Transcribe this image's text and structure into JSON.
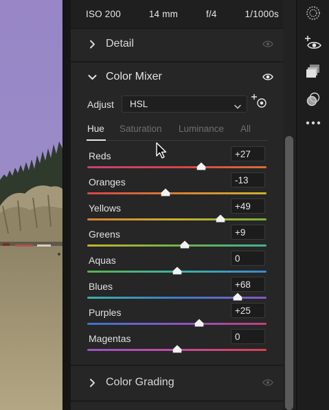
{
  "exif": {
    "iso": "ISO 200",
    "focal": "14 mm",
    "aperture": "f/4",
    "shutter": "1/1000s"
  },
  "sections": {
    "detail": {
      "title": "Detail"
    },
    "color_mixer": {
      "title": "Color Mixer",
      "adjust_label": "Adjust",
      "adjust_value": "HSL",
      "tabs": [
        "Hue",
        "Saturation",
        "Luminance",
        "All"
      ],
      "active_tab": "Hue",
      "sliders": [
        {
          "label": "Reds",
          "value": "+27",
          "position": 0.635
        },
        {
          "label": "Oranges",
          "value": "-13",
          "position": 0.435
        },
        {
          "label": "Yellows",
          "value": "+49",
          "position": 0.745
        },
        {
          "label": "Greens",
          "value": "+9",
          "position": 0.545
        },
        {
          "label": "Aquas",
          "value": "0",
          "position": 0.5
        },
        {
          "label": "Blues",
          "value": "+68",
          "position": 0.84
        },
        {
          "label": "Purples",
          "value": "+25",
          "position": 0.625
        },
        {
          "label": "Magentas",
          "value": "0",
          "position": 0.5
        }
      ]
    },
    "color_grading": {
      "title": "Color Grading"
    }
  },
  "colors": {
    "panel_bg": "#262626",
    "text": "#e6e6e6",
    "muted": "#6f6f6f"
  },
  "icons": {
    "eye": "eye-icon",
    "chevron_right": "chevron-right-icon",
    "chevron_down": "chevron-down-icon",
    "targeted_adjustment": "targeted-adjustment-icon",
    "tools": [
      "edit-icon",
      "red-eye-icon",
      "presets-icon",
      "versions-icon",
      "more-icon"
    ]
  }
}
